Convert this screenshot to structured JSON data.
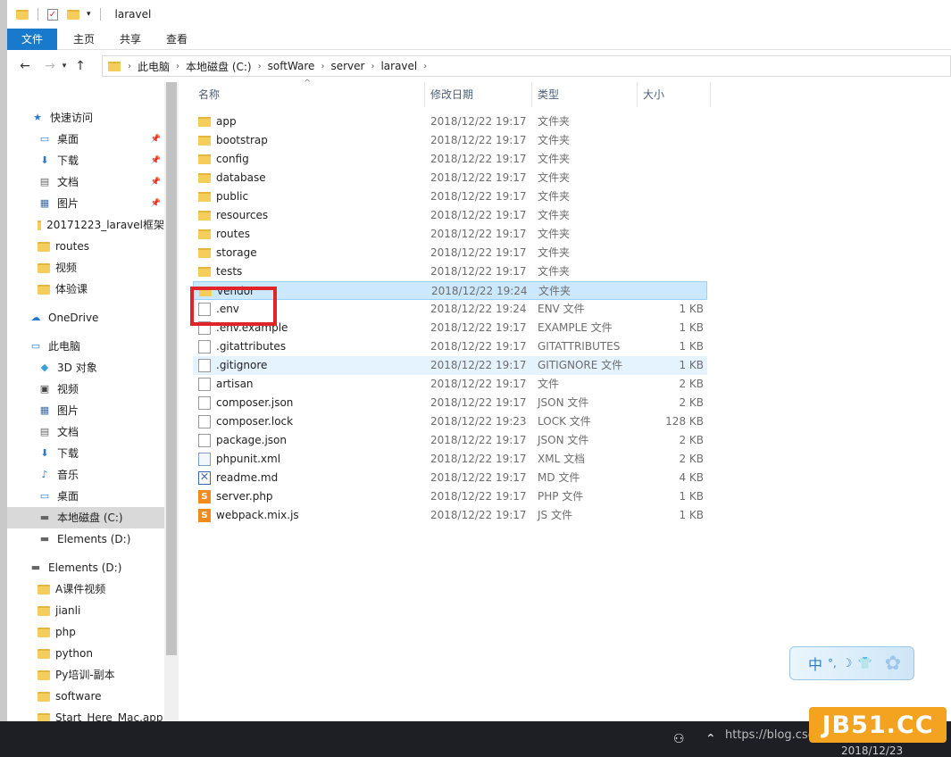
{
  "window": {
    "title": "laravel"
  },
  "ribbon": {
    "tabs": [
      "文件",
      "主页",
      "共享",
      "查看"
    ]
  },
  "address": {
    "crumbs": [
      "此电脑",
      "本地磁盘 (C:)",
      "softWare",
      "server",
      "laravel"
    ]
  },
  "sidebar": {
    "items": [
      {
        "label": "快速访问",
        "icon": "star-icon"
      },
      {
        "label": "桌面",
        "icon": "desktop-icon",
        "pinned": true
      },
      {
        "label": "下载",
        "icon": "download-icon",
        "pinned": true
      },
      {
        "label": "文档",
        "icon": "document-icon",
        "pinned": true
      },
      {
        "label": "图片",
        "icon": "picture-icon",
        "pinned": true
      },
      {
        "label": "20171223_laravel框架",
        "icon": "folder-icon"
      },
      {
        "label": "routes",
        "icon": "folder-icon"
      },
      {
        "label": "视频",
        "icon": "folder-icon"
      },
      {
        "label": "体验课",
        "icon": "folder-icon"
      },
      {
        "label": "OneDrive",
        "icon": "cloud-icon"
      },
      {
        "label": "此电脑",
        "icon": "computer-icon"
      },
      {
        "label": "3D 对象",
        "icon": "cube-icon"
      },
      {
        "label": "视频",
        "icon": "video-icon"
      },
      {
        "label": "图片",
        "icon": "picture-icon"
      },
      {
        "label": "文档",
        "icon": "document-icon"
      },
      {
        "label": "下载",
        "icon": "download-icon"
      },
      {
        "label": "音乐",
        "icon": "music-icon"
      },
      {
        "label": "桌面",
        "icon": "desktop-icon"
      },
      {
        "label": "本地磁盘 (C:)",
        "icon": "drive-icon",
        "selected": true
      },
      {
        "label": "Elements (D:)",
        "icon": "drive-icon"
      },
      {
        "label": "Elements (D:)",
        "icon": "drive-icon"
      },
      {
        "label": "A课件视频",
        "icon": "folder-icon"
      },
      {
        "label": "jianli",
        "icon": "folder-icon"
      },
      {
        "label": "php",
        "icon": "folder-icon"
      },
      {
        "label": "python",
        "icon": "folder-icon"
      },
      {
        "label": "Py培训-副本",
        "icon": "folder-icon"
      },
      {
        "label": "software",
        "icon": "folder-icon"
      },
      {
        "label": "Start_Here_Mac.app",
        "icon": "folder-icon"
      }
    ]
  },
  "columns": {
    "name": "名称",
    "date": "修改日期",
    "type": "类型",
    "size": "大小"
  },
  "files": [
    {
      "name": "app",
      "date": "2018/12/22 19:17",
      "type": "文件夹",
      "size": "",
      "icon": "folder-icon"
    },
    {
      "name": "bootstrap",
      "date": "2018/12/22 19:17",
      "type": "文件夹",
      "size": "",
      "icon": "folder-icon"
    },
    {
      "name": "config",
      "date": "2018/12/22 19:17",
      "type": "文件夹",
      "size": "",
      "icon": "folder-icon"
    },
    {
      "name": "database",
      "date": "2018/12/22 19:17",
      "type": "文件夹",
      "size": "",
      "icon": "folder-icon"
    },
    {
      "name": "public",
      "date": "2018/12/22 19:17",
      "type": "文件夹",
      "size": "",
      "icon": "folder-icon"
    },
    {
      "name": "resources",
      "date": "2018/12/22 19:17",
      "type": "文件夹",
      "size": "",
      "icon": "folder-icon"
    },
    {
      "name": "routes",
      "date": "2018/12/22 19:17",
      "type": "文件夹",
      "size": "",
      "icon": "folder-icon"
    },
    {
      "name": "storage",
      "date": "2018/12/22 19:17",
      "type": "文件夹",
      "size": "",
      "icon": "folder-icon"
    },
    {
      "name": "tests",
      "date": "2018/12/22 19:17",
      "type": "文件夹",
      "size": "",
      "icon": "folder-icon"
    },
    {
      "name": "vendor",
      "date": "2018/12/22 19:24",
      "type": "文件夹",
      "size": "",
      "icon": "folder-icon",
      "selected": true
    },
    {
      "name": ".env",
      "date": "2018/12/22 19:24",
      "type": "ENV 文件",
      "size": "1 KB",
      "icon": "file-icon"
    },
    {
      "name": ".env.example",
      "date": "2018/12/22 19:17",
      "type": "EXAMPLE 文件",
      "size": "1 KB",
      "icon": "file-icon"
    },
    {
      "name": ".gitattributes",
      "date": "2018/12/22 19:17",
      "type": "GITATTRIBUTES",
      "size": "1 KB",
      "icon": "file-icon"
    },
    {
      "name": ".gitignore",
      "date": "2018/12/22 19:17",
      "type": "GITIGNORE 文件",
      "size": "1 KB",
      "icon": "file-icon",
      "hover": true
    },
    {
      "name": "artisan",
      "date": "2018/12/22 19:17",
      "type": "文件",
      "size": "2 KB",
      "icon": "file-icon"
    },
    {
      "name": "composer.json",
      "date": "2018/12/22 19:17",
      "type": "JSON 文件",
      "size": "2 KB",
      "icon": "file-icon"
    },
    {
      "name": "composer.lock",
      "date": "2018/12/22 19:23",
      "type": "LOCK 文件",
      "size": "128 KB",
      "icon": "file-icon"
    },
    {
      "name": "package.json",
      "date": "2018/12/22 19:17",
      "type": "JSON 文件",
      "size": "2 KB",
      "icon": "file-icon"
    },
    {
      "name": "phpunit.xml",
      "date": "2018/12/22 19:17",
      "type": "XML 文档",
      "size": "2 KB",
      "icon": "xml-icon"
    },
    {
      "name": "readme.md",
      "date": "2018/12/22 19:17",
      "type": "MD 文件",
      "size": "4 KB",
      "icon": "markdown-icon"
    },
    {
      "name": "server.php",
      "date": "2018/12/22 19:17",
      "type": "PHP 文件",
      "size": "1 KB",
      "icon": "sublime-icon"
    },
    {
      "name": "webpack.mix.js",
      "date": "2018/12/22 19:17",
      "type": "JS 文件",
      "size": "1 KB",
      "icon": "sublime-icon"
    }
  ],
  "ime": {
    "lang": "中"
  },
  "taskbar": {
    "date": "2018/12/23",
    "watermark_text": "https://blog.csdn.net/weixin_4..."
  },
  "watermark": {
    "text": "JB51.CC"
  },
  "colors": {
    "accent": "#1979ca",
    "selection": "#cce8ff",
    "highlight_box": "#e0242a",
    "folder": "#f4cd5a"
  }
}
